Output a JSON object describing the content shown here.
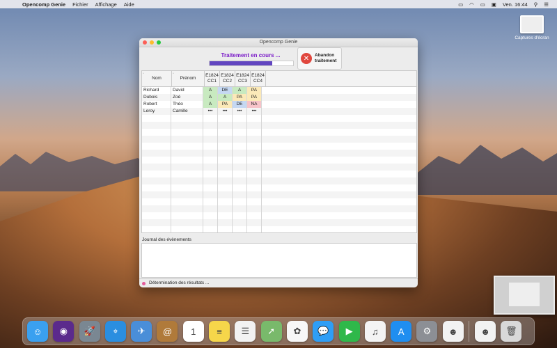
{
  "menubar": {
    "app_name": "Opencomp Genie",
    "menus": [
      "Fichier",
      "Affichage",
      "Aide"
    ],
    "clock": "Ven. 16:44"
  },
  "desktop": {
    "icon_label": "Captures d'écran"
  },
  "window": {
    "title": "Opencomp Genie",
    "progress": {
      "label": "Traitement en cours ...",
      "percent": 75
    },
    "abort_button": {
      "line1": "Abandon",
      "line2": "traitement"
    },
    "table": {
      "headers": [
        "Nom",
        "Prénom",
        "E1824\nCC1",
        "E1824\nCC2",
        "E1824\nCC3",
        "E1824\nCC4"
      ],
      "rows": [
        [
          "Richard",
          "David",
          "A",
          "DE",
          "A",
          "PA"
        ],
        [
          "Dubois",
          "Zoé",
          "A",
          "A",
          "PA",
          "PA"
        ],
        [
          "Robert",
          "Théo",
          "A",
          "PA",
          "DE",
          "NA"
        ],
        [
          "Leroy",
          "Camille",
          "•••",
          "•••",
          "•••",
          "•••"
        ]
      ],
      "empty_rows": 19
    },
    "journal_label": "Journal des évènements",
    "status_text": "Détermination des résultats ..."
  },
  "colors": {
    "A": "#c8eac0",
    "DE": "#c5d8f2",
    "PA": "#fbe9b8",
    "NA": "#f6c3c9",
    "progress": "#6145c0",
    "progress_text": "#7a1ac8"
  },
  "dock": [
    {
      "name": "finder-icon",
      "glyph": "☺",
      "color": "#3aa0f0"
    },
    {
      "name": "siri-icon",
      "glyph": "◉",
      "color": "#5b2a8c"
    },
    {
      "name": "launchpad-icon",
      "glyph": "🚀",
      "color": "#7a8792"
    },
    {
      "name": "safari-icon",
      "glyph": "⌖",
      "color": "#2a8ee0"
    },
    {
      "name": "mail-icon",
      "glyph": "✈",
      "color": "#4a8ed8"
    },
    {
      "name": "contacts-icon",
      "glyph": "@",
      "color": "#b07a3a"
    },
    {
      "name": "calendar-icon",
      "glyph": "1",
      "color": "#ffffff"
    },
    {
      "name": "notes-icon",
      "glyph": "≡",
      "color": "#f6d64a"
    },
    {
      "name": "reminders-icon",
      "glyph": "☰",
      "color": "#f2f2f2"
    },
    {
      "name": "maps-icon",
      "glyph": "➚",
      "color": "#79b96b"
    },
    {
      "name": "photos-icon",
      "glyph": "✿",
      "color": "#f7f7f7"
    },
    {
      "name": "messages-icon",
      "glyph": "💬",
      "color": "#2f9ef5"
    },
    {
      "name": "facetime-icon",
      "glyph": "▶",
      "color": "#2fb84a"
    },
    {
      "name": "itunes-icon",
      "glyph": "♫",
      "color": "#f4f4f4"
    },
    {
      "name": "appstore-icon",
      "glyph": "A",
      "color": "#1f8ef0"
    },
    {
      "name": "system-preferences-icon",
      "glyph": "⚙",
      "color": "#8c8f95"
    },
    {
      "name": "genie-icon",
      "glyph": "☻",
      "color": "#f2f2f2"
    },
    {
      "name": "genie-icon-2",
      "glyph": "☻",
      "color": "#f2f2f2"
    },
    {
      "name": "trash-icon",
      "glyph": "🗑",
      "color": "#d8d8d8"
    }
  ]
}
